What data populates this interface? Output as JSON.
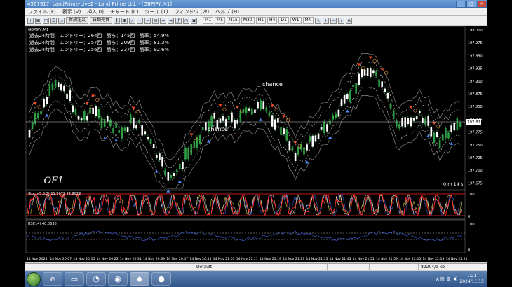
{
  "window": {
    "title": "4567917: LandPrime-Live2 - Land Prime Ltd. - [GBPJPY,M1]"
  },
  "menu": [
    "ファイル (F)",
    "表示 (V)",
    "挿入 (I)",
    "チャート (C)",
    "ツール (T)",
    "ウィンドウ (W)",
    "ヘルプ (H)"
  ],
  "toolbar": {
    "new_order": "新規注文",
    "auto_trade": "自動売買",
    "timeframes": [
      "M1",
      "M5",
      "M15",
      "M30",
      "H1",
      "H4",
      "D1",
      "W1",
      "MN"
    ]
  },
  "chart": {
    "symbol_label": "GBPJPY,M1",
    "stats": [
      "過去24時間　エントリー：264回　勝ち：145回　勝率：54.9%",
      "過去24時間　エントリー：257回　勝ち：209回　勝率：81.3%",
      "過去24時間　エントリー：256回　勝ち：237回　勝率：92.6%"
    ],
    "annotations": [
      "chance",
      "chance"
    ],
    "watermark": "- OF1 -",
    "countdown": "0 m 14 s",
    "price_labels": [
      "198.000",
      "197.975",
      "197.950",
      "197.925",
      "197.900",
      "197.875",
      "197.850",
      "197.825",
      "197.811",
      "197.775",
      "197.750",
      "197.725",
      "197.700",
      "197.675"
    ],
    "current_price": "197.811",
    "stoch_label": "Stoch(5,3,3) 11.9672 22.9022",
    "stoch_levels": [
      "100",
      "0"
    ],
    "rsi_label": "RSI(14) 40.0638",
    "rsi_levels": [
      "100",
      "0"
    ],
    "time_labels": [
      "14 Nov 2024",
      "14 Nov 20:07",
      "14 Nov 20:15",
      "14 Nov 20:23",
      "14 Nov 20:31",
      "14 Nov 20:39",
      "14 Nov 20:47",
      "14 Nov 20:55",
      "14 Nov 21:03",
      "14 Nov 21:11",
      "14 Nov 21:19",
      "14 Nov 21:27",
      "14 Nov 21:35",
      "14 Nov 21:43",
      "14 Nov 21:51",
      "14 Nov 21:59",
      "14 Nov 22:05",
      "14 Nov 22:13",
      "14 Nov 22:21"
    ]
  },
  "status": {
    "profile": "Default",
    "traffic": "82204/9 kb"
  },
  "taskbar": {
    "apps": [
      "start-orb",
      "ie-icon",
      "explorer-icon",
      "edge-icon",
      "chrome-icon",
      "mt4-icon",
      "record-icon"
    ],
    "time": "7:21",
    "date": "2024/11/15",
    "tray_text": "A 般"
  },
  "colors": {
    "bull_candle": "#2ea043",
    "bear_candle": "#ffffff",
    "up_arrow": "#4a8cff",
    "down_arrow": "#ff4a1c",
    "stoch_main": "#ff2020",
    "stoch_signal": "#ffffff",
    "rsi_line": "#3a5bd0"
  }
}
